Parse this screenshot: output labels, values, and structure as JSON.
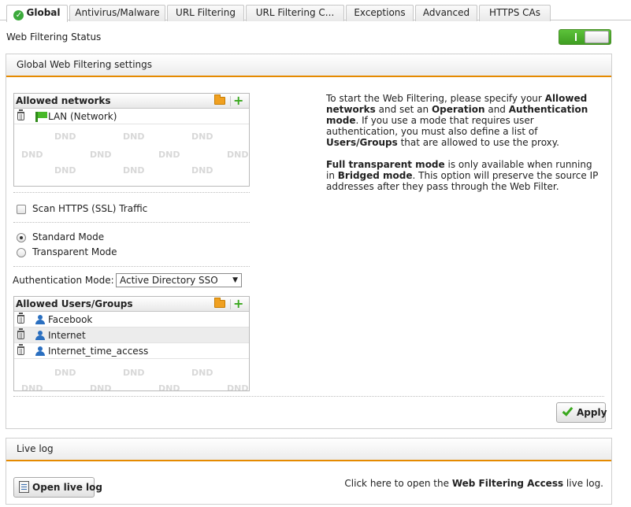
{
  "tabs": [
    {
      "label": "Global",
      "active": true
    },
    {
      "label": "Antivirus/Malware",
      "active": false
    },
    {
      "label": "URL Filtering",
      "active": false
    },
    {
      "label": "URL Filtering C...",
      "active": false
    },
    {
      "label": "Exceptions",
      "active": false
    },
    {
      "label": "Advanced",
      "active": false
    },
    {
      "label": "HTTPS CAs",
      "active": false
    }
  ],
  "status": {
    "label": "Web Filtering Status",
    "enabled": true,
    "toggle_text": "I"
  },
  "settings": {
    "title": "Global Web Filtering settings",
    "allowed_networks": {
      "header": "Allowed networks",
      "rows": [
        {
          "label": "LAN (Network)",
          "icon": "network-flag-icon"
        }
      ]
    },
    "dnd_label": "DND",
    "scan_https": {
      "label": "Scan HTTPS (SSL) Traffic",
      "checked": false
    },
    "modes": [
      {
        "label": "Standard Mode",
        "selected": true
      },
      {
        "label": "Transparent Mode",
        "selected": false
      }
    ],
    "auth": {
      "label": "Authentication Mode:",
      "value": "Active Directory SSO"
    },
    "allowed_users": {
      "header": "Allowed Users/Groups",
      "rows": [
        {
          "label": "Facebook",
          "icon": "user-group-icon"
        },
        {
          "label": "Internet",
          "icon": "user-group-icon"
        },
        {
          "label": "Internet_time_access",
          "icon": "user-group-icon"
        }
      ]
    },
    "help": {
      "p1": [
        {
          "t": "To start the Web Filtering, please specify your ",
          "b": false
        },
        {
          "t": "Allowed networks",
          "b": true
        },
        {
          "t": " and set an ",
          "b": false
        },
        {
          "t": "Operation",
          "b": true
        },
        {
          "t": " and ",
          "b": false
        },
        {
          "t": "Authentication mode",
          "b": true
        },
        {
          "t": ". If you use a mode that requires user authentication, you must also define a list of ",
          "b": false
        },
        {
          "t": "Users/Groups",
          "b": true
        },
        {
          "t": " that are allowed to use the proxy.",
          "b": false
        }
      ],
      "p2": [
        {
          "t": "Full transparent mode",
          "b": true
        },
        {
          "t": " is only available when running in ",
          "b": false
        },
        {
          "t": "Bridged mode",
          "b": true
        },
        {
          "t": ". This option will preserve the source IP addresses after they pass through the Web Filter.",
          "b": false
        }
      ]
    },
    "apply_label": "Apply"
  },
  "live_log": {
    "title": "Live log",
    "button_label": "Open live log",
    "text_prefix": "Click here to open the ",
    "text_bold": "Web Filtering Access",
    "text_suffix": " live log."
  },
  "colors": {
    "accent": "#e58a00",
    "toggle_on": "#4aae2a",
    "plus": "#3aa81e",
    "user": "#2a6fc0"
  }
}
